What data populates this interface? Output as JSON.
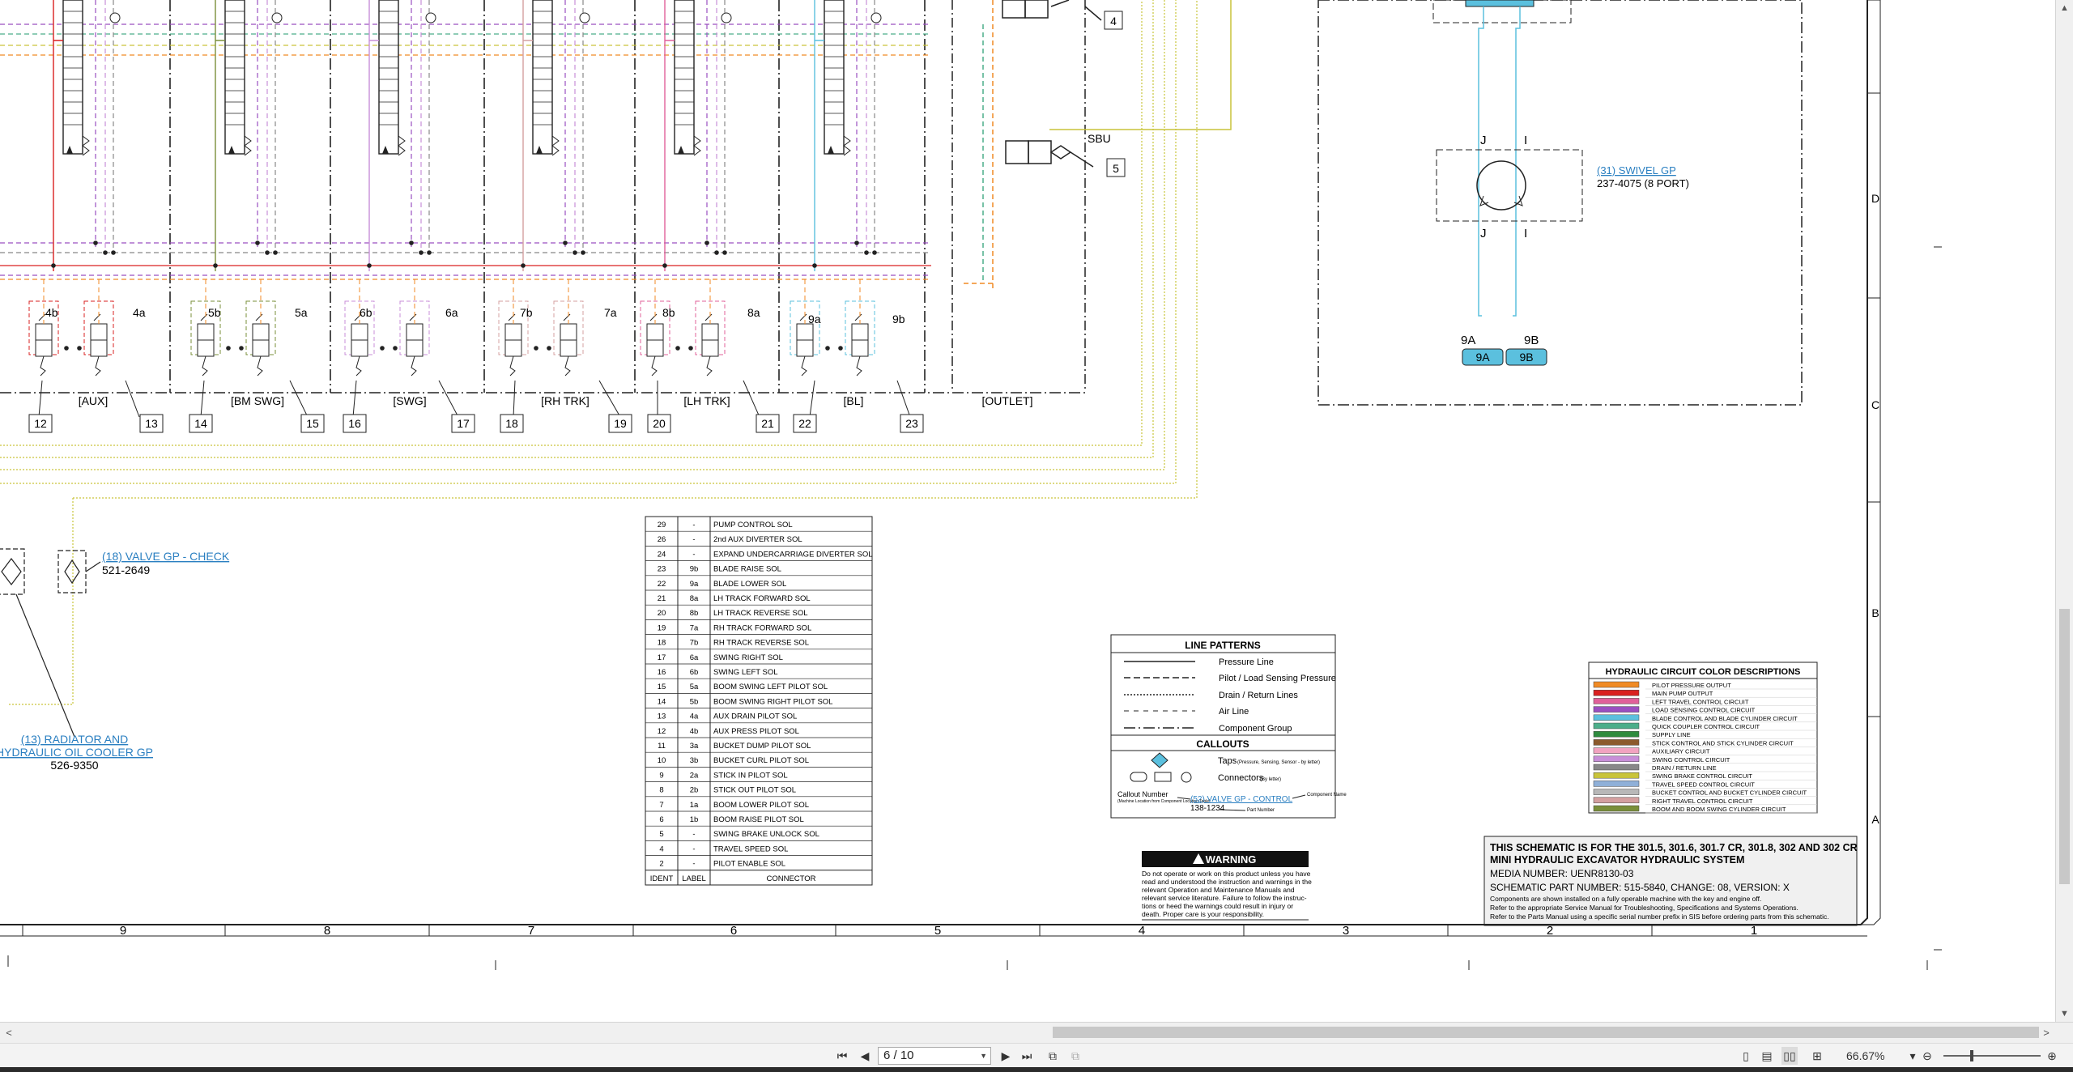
{
  "schematic": {
    "valve_labels": [
      "[AUX]",
      "[BM SWG]",
      "[SWG]",
      "[RH TRK]",
      "[LH TRK]",
      "[BL]",
      "[OUTLET]"
    ],
    "connector_ids": [
      "12",
      "13",
      "14",
      "15",
      "16",
      "17",
      "18",
      "19",
      "20",
      "21",
      "22",
      "23"
    ],
    "solenoid_labels": [
      "4b",
      "4a",
      "5b",
      "5a",
      "6b",
      "6a",
      "7b",
      "7a",
      "8b",
      "8a",
      "9a",
      "9b"
    ],
    "callouts_right": [
      "4",
      "5"
    ],
    "sbu": "SBU",
    "swivel": {
      "link": "(31) SWIVEL GP",
      "part": "237-4075 (8 PORT)",
      "port_j": "J",
      "port_i": "I",
      "tag_9a": "9A",
      "tag_9b": "9B"
    },
    "check_valve": {
      "link": "(18) VALVE GP - CHECK",
      "part": "521-2649"
    },
    "radiator": {
      "link_line1": "(13) RADIATOR AND",
      "link_line2": "HYDRAULIC OIL COOLER GP",
      "part": "526-9350"
    },
    "border_letters": [
      "D",
      "C",
      "B",
      "A"
    ],
    "border_numbers": [
      "9",
      "8",
      "7",
      "6",
      "5",
      "4",
      "3",
      "2",
      "1"
    ]
  },
  "connector_table": {
    "headers": [
      "IDENT",
      "LABEL",
      "CONNECTOR"
    ],
    "rows": [
      [
        "29",
        "-",
        "PUMP CONTROL SOL"
      ],
      [
        "26",
        "-",
        "2nd AUX DIVERTER SOL"
      ],
      [
        "24",
        "-",
        "EXPAND UNDERCARRIAGE DIVERTER SOL"
      ],
      [
        "23",
        "9b",
        "BLADE RAISE SOL"
      ],
      [
        "22",
        "9a",
        "BLADE LOWER SOL"
      ],
      [
        "21",
        "8a",
        "LH TRACK FORWARD SOL"
      ],
      [
        "20",
        "8b",
        "LH TRACK REVERSE SOL"
      ],
      [
        "19",
        "7a",
        "RH TRACK FORWARD SOL"
      ],
      [
        "18",
        "7b",
        "RH TRACK REVERSE SOL"
      ],
      [
        "17",
        "6a",
        "SWING RIGHT SOL"
      ],
      [
        "16",
        "6b",
        "SWING LEFT SOL"
      ],
      [
        "15",
        "5a",
        "BOOM SWING LEFT PILOT SOL"
      ],
      [
        "14",
        "5b",
        "BOOM SWING RIGHT PILOT SOL"
      ],
      [
        "13",
        "4a",
        "AUX DRAIN PILOT SOL"
      ],
      [
        "12",
        "4b",
        "AUX PRESS PILOT SOL"
      ],
      [
        "11",
        "3a",
        "BUCKET DUMP PILOT SOL"
      ],
      [
        "10",
        "3b",
        "BUCKET CURL PILOT SOL"
      ],
      [
        "9",
        "2a",
        "STICK IN PILOT SOL"
      ],
      [
        "8",
        "2b",
        "STICK OUT PILOT SOL"
      ],
      [
        "7",
        "1a",
        "BOOM LOWER PILOT SOL"
      ],
      [
        "6",
        "1b",
        "BOOM RAISE PILOT SOL"
      ],
      [
        "5",
        "-",
        "SWING BRAKE UNLOCK SOL"
      ],
      [
        "4",
        "-",
        "TRAVEL SPEED SOL"
      ],
      [
        "2",
        "-",
        "PILOT ENABLE SOL"
      ]
    ]
  },
  "line_patterns": {
    "title": "LINE PATTERNS",
    "items": [
      "Pressure Line",
      "Pilot / Load Sensing Pressure",
      "Drain / Return Lines",
      "Air Line",
      "Component Group"
    ],
    "callouts_title": "CALLOUTS",
    "taps": "Taps",
    "taps_note": "(Pressure, Sensing, Sensor - by letter)",
    "connectors": "Connectors",
    "connectors_note": "(By letter)",
    "callout_number": "Callout Number",
    "callout_note": "(Machine Location from Component Location Table)",
    "example_link": "(52) VALVE GP - CONTROL",
    "example_part": "138-1234",
    "component_name": "Component Name",
    "part_number": "Part Number"
  },
  "warning": {
    "title": "WARNING",
    "text": [
      "Do not operate or work on this product unless you have",
      "read and understood the instruction and warnings in the",
      "relevant Operation and Maintenance Manuals and",
      "relevant service literature. Failure to follow the instruc-",
      "tions or heed the warnings could result in injury or",
      "death. Proper care is your responsibility."
    ]
  },
  "color_descriptions": {
    "title": "HYDRAULIC CIRCUIT COLOR DESCRIPTIONS",
    "items": [
      {
        "label": "PILOT PRESSURE OUTPUT",
        "color": "#f08a24"
      },
      {
        "label": "MAIN PUMP OUTPUT",
        "color": "#d92020"
      },
      {
        "label": "LEFT TRAVEL CONTROL CIRCUIT",
        "color": "#e0609a"
      },
      {
        "label": "LOAD SENSING CONTROL CIRCUIT",
        "color": "#9a4fc0"
      },
      {
        "label": "BLADE CONTROL AND BLADE CYLINDER CIRCUIT",
        "color": "#5bc0de"
      },
      {
        "label": "QUICK COUPLER CONTROL CIRCUIT",
        "color": "#4cae8a"
      },
      {
        "label": "SUPPLY LINE",
        "color": "#2e8b3e"
      },
      {
        "label": "STICK CONTROL AND STICK CYLINDER CIRCUIT",
        "color": "#8b5a2b"
      },
      {
        "label": "AUXILIARY CIRCUIT",
        "color": "#f2a3c0"
      },
      {
        "label": "SWING CONTROL CIRCUIT",
        "color": "#c88fd8"
      },
      {
        "label": "DRAIN / RETURN LINE",
        "color": "#888888"
      },
      {
        "label": "SWING BRAKE CONTROL CIRCUIT",
        "color": "#c9c43a"
      },
      {
        "label": "TRAVEL SPEED CONTROL CIRCUIT",
        "color": "#8fb0d8"
      },
      {
        "label": "BUCKET CONTROL AND BUCKET CYLINDER CIRCUIT",
        "color": "#b8b8b8"
      },
      {
        "label": "RIGHT TRAVEL CONTROL CIRCUIT",
        "color": "#d4a0a0"
      },
      {
        "label": "BOOM AND BOOM SWING CYLINDER CIRCUIT",
        "color": "#7a8f3a"
      }
    ]
  },
  "title_block": {
    "line1": "THIS SCHEMATIC IS FOR THE 301.5, 301.6, 301.7 CR, 301.8, 302 AND 302 CR",
    "line2": "MINI HYDRAULIC EXCAVATOR HYDRAULIC SYSTEM",
    "media": "MEDIA NUMBER: UENR8130-03",
    "part": "SCHEMATIC PART NUMBER: 515-5840, CHANGE: 08, VERSION: X",
    "note1": "Components are shown installed on a fully operable machine with the key and engine off.",
    "note2": "Refer to the appropriate Service Manual for Troubleshooting, Specifications and Systems Operations.",
    "note3": "Refer to the Parts Manual using a specific serial number prefix in SIS before ordering parts from this schematic."
  },
  "viewer": {
    "page": "6 / 10",
    "zoom": "66.67%"
  }
}
